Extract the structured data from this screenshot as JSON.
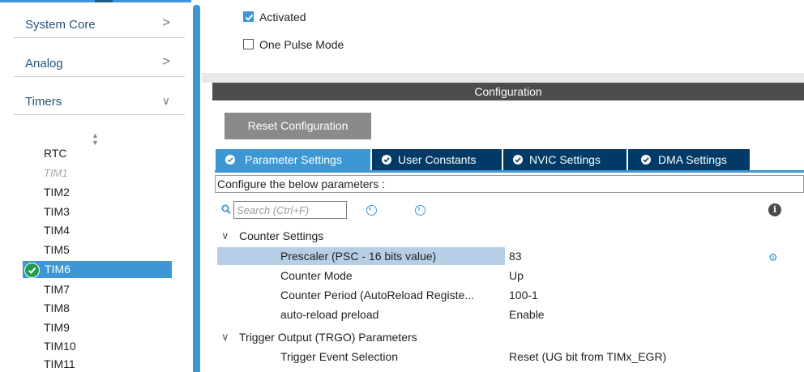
{
  "sidebar": {
    "categories": [
      {
        "label": "System Core",
        "chevron": ">"
      },
      {
        "label": "Analog",
        "chevron": ">"
      },
      {
        "label": "Timers",
        "chevron": "∨"
      }
    ],
    "sort_icon": "sort-arrows-icon",
    "timers": [
      "RTC",
      "TIM1",
      "TIM2",
      "TIM3",
      "TIM4",
      "TIM5",
      "TIM6",
      "TIM7",
      "TIM8",
      "TIM9",
      "TIM10",
      "TIM11"
    ],
    "selected_timer": "TIM6",
    "disabled_timer": "TIM1"
  },
  "mode": {
    "activated_label": "Activated",
    "activated_checked": true,
    "one_pulse_label": "One Pulse Mode",
    "one_pulse_checked": false
  },
  "configuration": {
    "header": "Configuration",
    "reset_label": "Reset Configuration",
    "tabs": [
      {
        "label": "Parameter Settings",
        "active": true
      },
      {
        "label": "User Constants",
        "active": false
      },
      {
        "label": "NVIC Settings",
        "active": false
      },
      {
        "label": "DMA Settings",
        "active": false
      }
    ],
    "description": "Configure the below parameters :",
    "search_placeholder": "Search (Ctrl+F)",
    "groups": {
      "counter": {
        "label": "Counter Settings",
        "params": [
          {
            "name": "Prescaler (PSC - 16 bits value)",
            "value": "83"
          },
          {
            "name": "Counter Mode",
            "value": "Up"
          },
          {
            "name": "Counter Period (AutoReload Registe...",
            "value": "100-1"
          },
          {
            "name": "auto-reload preload",
            "value": "Enable"
          }
        ]
      },
      "trgo": {
        "label": "Trigger Output (TRGO) Parameters",
        "params": [
          {
            "name": "Trigger Event Selection",
            "value": "Reset (UG bit from TIMx_EGR)"
          }
        ]
      }
    }
  },
  "colors": {
    "accent": "#3c97d4",
    "tab_dark": "#003a66",
    "header_dark": "#4d4d4d",
    "selected_row": "#b7cfe6",
    "enabled_green": "#1d9d52"
  }
}
